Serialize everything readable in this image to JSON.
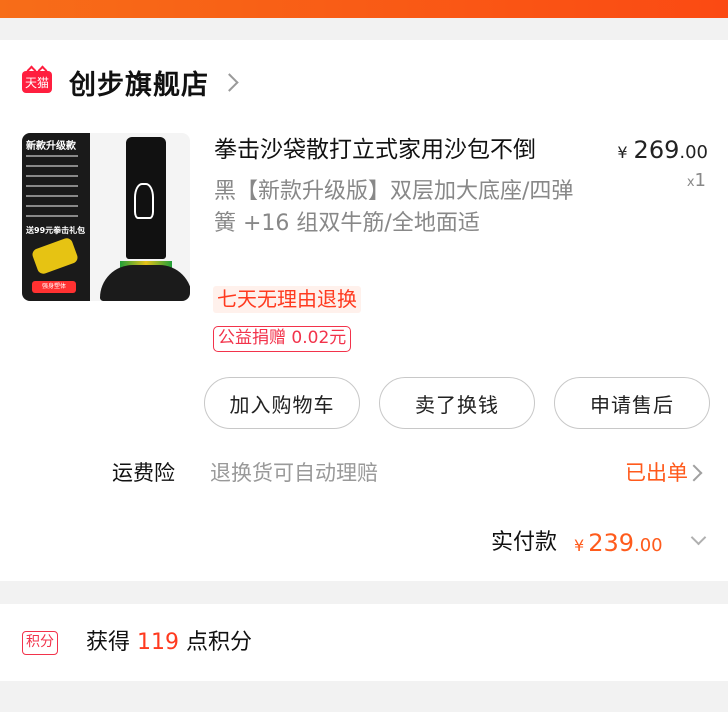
{
  "shop": {
    "badge": "天猫",
    "name": "创步旗舰店"
  },
  "thumbnail": {
    "headline": "新款升级款",
    "gift_text": "送99元拳击礼包",
    "tag": "强身塑体"
  },
  "item": {
    "title": "拳击沙袋散打立式家用沙包不倒",
    "spec": "黑【新款升级版】双层加大底座/四弹簧 +16 组双牛筋/全地面适",
    "price_symbol": "¥",
    "price_int": "269",
    "price_dec": ".00",
    "qty_x": "x",
    "qty": "1",
    "tag_return": "七天无理由退换",
    "tag_charity": "公益捐赠 0.02元"
  },
  "actions": {
    "add_cart": "加入购物车",
    "resell": "卖了换钱",
    "after_sales": "申请售后"
  },
  "insurance": {
    "label": "运费险",
    "desc": "退换货可自动理赔",
    "status": "已出单"
  },
  "payment": {
    "label": "实付款",
    "symbol": "¥",
    "amount_int": "239",
    "amount_dec": ".00"
  },
  "points": {
    "badge": "积分",
    "prefix": "获得 ",
    "value": "119",
    "suffix": " 点积分"
  },
  "colors": {
    "accent": "#ff5a1c",
    "tmall_red": "#ff1f3f",
    "header_gradient": "#f76d18"
  }
}
